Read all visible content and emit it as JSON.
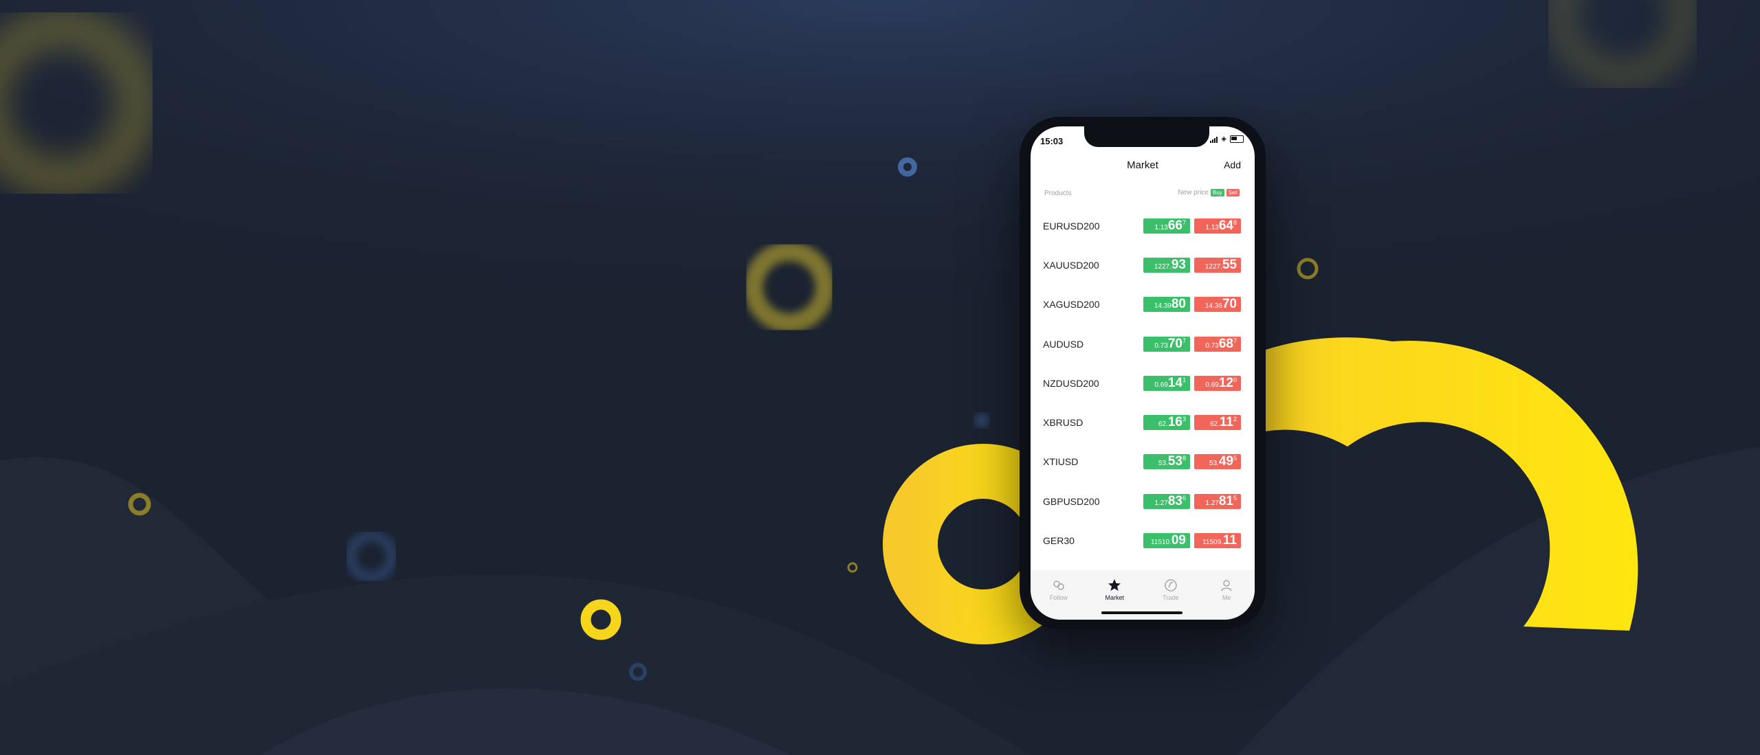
{
  "phone": {
    "status": {
      "time": "15:03"
    },
    "header": {
      "title": "Market",
      "add_label": "Add"
    },
    "columns": {
      "products": "Products",
      "new_price": "New price",
      "buy": "Buy",
      "sell": "Sell"
    },
    "rows": [
      {
        "symbol": "EURUSD200",
        "buy": {
          "small": "1.13",
          "big": "66",
          "pip": "7"
        },
        "sell": {
          "small": "1.13",
          "big": "64",
          "pip": "8"
        }
      },
      {
        "symbol": "XAUUSD200",
        "buy": {
          "small": "1227.",
          "big": "93",
          "pip": ""
        },
        "sell": {
          "small": "1227.",
          "big": "55",
          "pip": ""
        }
      },
      {
        "symbol": "XAGUSD200",
        "buy": {
          "small": "14.39",
          "big": "80",
          "pip": ""
        },
        "sell": {
          "small": "14.36",
          "big": "70",
          "pip": ""
        }
      },
      {
        "symbol": "AUDUSD",
        "buy": {
          "small": "0.73",
          "big": "70",
          "pip": "7"
        },
        "sell": {
          "small": "0.73",
          "big": "68",
          "pip": "7"
        }
      },
      {
        "symbol": "NZDUSD200",
        "buy": {
          "small": "0.69",
          "big": "14",
          "pip": "1"
        },
        "sell": {
          "small": "0.69",
          "big": "12",
          "pip": "0"
        }
      },
      {
        "symbol": "XBRUSD",
        "buy": {
          "small": "62.",
          "big": "16",
          "pip": "3"
        },
        "sell": {
          "small": "62.",
          "big": "11",
          "pip": "2"
        }
      },
      {
        "symbol": "XTIUSD",
        "buy": {
          "small": "53.",
          "big": "53",
          "pip": "8"
        },
        "sell": {
          "small": "53.",
          "big": "49",
          "pip": "5"
        }
      },
      {
        "symbol": "GBPUSD200",
        "buy": {
          "small": "1.27",
          "big": "83",
          "pip": "6"
        },
        "sell": {
          "small": "1.27",
          "big": "81",
          "pip": "5"
        }
      },
      {
        "symbol": "GER30",
        "buy": {
          "small": "11510.",
          "big": "09",
          "pip": ""
        },
        "sell": {
          "small": "11509.",
          "big": "11",
          "pip": ""
        }
      }
    ],
    "tabs": [
      {
        "label": "Follow",
        "icon": "follow-icon",
        "active": false
      },
      {
        "label": "Market",
        "icon": "market-star-icon",
        "active": true
      },
      {
        "label": "Trade",
        "icon": "trade-icon",
        "active": false
      },
      {
        "label": "Me",
        "icon": "person-icon",
        "active": false
      }
    ]
  },
  "colors": {
    "background": "#1b2230",
    "accent_yellow": "#ffdf1a",
    "buy_green": "#3cbf6a",
    "sell_red": "#f1655b"
  }
}
